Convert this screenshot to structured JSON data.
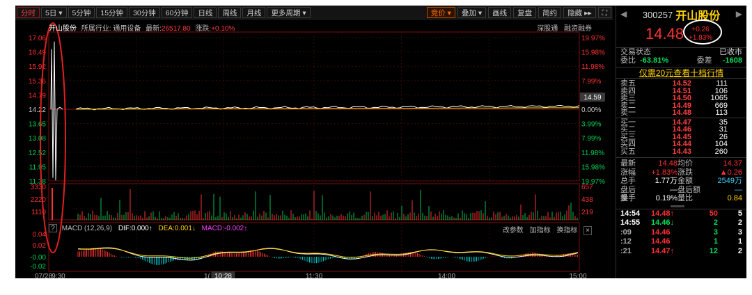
{
  "toolbar": {
    "periods": [
      "分时",
      "5日 ▾",
      "5分钟",
      "15分钟",
      "30分钟",
      "60分钟",
      "日线",
      "周线",
      "月线",
      "更多周期 ▾"
    ],
    "right": [
      "竞价 ▾",
      "叠加 ▾",
      "画线",
      "复盘",
      "简约",
      "隐藏 ▸▸"
    ]
  },
  "stock_info": {
    "name": "开山股份",
    "industry": "所属行业: 通用设备",
    "latest_label": "最新:",
    "latest": "26517.80",
    "change_label": "涨跌:",
    "change": "+0.10%"
  },
  "links": [
    "深股通",
    "融资融券"
  ],
  "price_axis": {
    "left": [
      "17.06",
      "16.49",
      "15.92",
      "15.36",
      "14.79",
      "14.22",
      "13.65",
      "13.08",
      "12.52",
      "11.95",
      "11.38"
    ],
    "right": [
      "19.97%",
      "15.98%",
      "11.98%",
      "7.99%",
      "3.99%",
      "0.00%",
      "3.99%",
      "7.99%",
      "11.98%",
      "15.98%",
      "19.97%"
    ],
    "current_tag": "14.59"
  },
  "volume_axis": {
    "left": [
      "3330",
      "2220",
      "1110"
    ],
    "right": [
      "657",
      "438",
      "219"
    ]
  },
  "macd": {
    "help": "?",
    "title": "MACD (12,26,9)",
    "dif": "DIF:0.000↑",
    "dea": "DEA:0.001↓",
    "macd": "MACD:-0.002↑",
    "tools": [
      "改参数",
      "加指标",
      "换指标"
    ],
    "close": "×",
    "axis": [
      "0.04",
      "0.02",
      "-0.00",
      "-0.02"
    ]
  },
  "time_axis": {
    "labels": [
      "07/28",
      "9:30",
      "1(",
      "11:30",
      "14:00",
      "15:00"
    ],
    "cursor": "10:28"
  },
  "panel": {
    "code": "300257",
    "name": "开山股份",
    "price": "14.48",
    "change": "+0.26",
    "change_pct": "+1.83%",
    "status_label": "交易状态",
    "status_value": "已收市",
    "weibi_label": "委比",
    "weibi_value": "-63.81%",
    "weicha_label": "委差",
    "weicha_value": "-1608",
    "banner": "仅需20元查看十档行情",
    "asks": [
      {
        "label": "卖五",
        "price": "14.52",
        "vol": "111"
      },
      {
        "label": "卖四",
        "price": "14.51",
        "vol": "106"
      },
      {
        "label": "卖三",
        "price": "14.50",
        "vol": "1065"
      },
      {
        "label": "卖二",
        "price": "14.49",
        "vol": "669"
      },
      {
        "label": "卖一",
        "price": "14.48",
        "vol": "113"
      }
    ],
    "bids": [
      {
        "label": "买一",
        "price": "14.47",
        "vol": "35"
      },
      {
        "label": "买二",
        "price": "14.46",
        "vol": "31"
      },
      {
        "label": "买三",
        "price": "14.45",
        "vol": "26"
      },
      {
        "label": "买四",
        "price": "14.44",
        "vol": "104"
      },
      {
        "label": "买五",
        "price": "14.43",
        "vol": "260"
      }
    ],
    "stats": [
      {
        "k1": "最新",
        "v1": "14.48",
        "k2": "均价",
        "v2": "14.37"
      },
      {
        "k1": "涨幅",
        "v1": "+1.83%",
        "k2": "涨跌",
        "v2": "▲0.26"
      },
      {
        "k1": "总手",
        "v1": "1.77万",
        "k2": "金额",
        "v2": "2549万"
      },
      {
        "k1": "盘后量",
        "v1": "—",
        "k2": "盘后额",
        "v2": "—"
      },
      {
        "k1": "换手",
        "v1": "0.19%",
        "k2": "量比",
        "v2": "0.84"
      }
    ],
    "ticks": [
      {
        "time": "14:54",
        "price": "14.48↑",
        "vol": "50",
        "n": "5"
      },
      {
        "time": "14:55",
        "price": "14.46↓",
        "vol": "2",
        "n": "2"
      },
      {
        "time": ":09",
        "price": "14.46",
        "vol": "3",
        "n": "3"
      },
      {
        "time": ":12",
        "price": "14.46",
        "vol": "1",
        "n": "1"
      },
      {
        "time": ":21",
        "price": "14.47↑",
        "vol": "12",
        "n": "2"
      }
    ]
  },
  "colors": {
    "up": "#ff3232",
    "down": "#00e05a",
    "price_line": "#ffffff",
    "avg_line": "#ffd200",
    "accent": "#ffd200"
  }
}
